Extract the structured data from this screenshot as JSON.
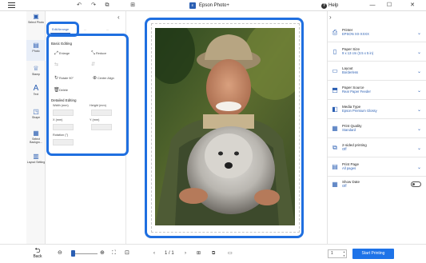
{
  "window": {
    "title": "Epson Photo+",
    "logo_text": "E",
    "help_label": "Help"
  },
  "left_rail": {
    "items": [
      {
        "label": "Select Photo",
        "icon": "photo-select-icon"
      },
      {
        "label": "Photo",
        "icon": "photo-icon"
      },
      {
        "label": "Stamp",
        "icon": "stamp-icon"
      },
      {
        "label": "Text",
        "icon": "text-icon"
      },
      {
        "label": "Shape",
        "icon": "shape-icon"
      },
      {
        "label": "Select Backgro...",
        "icon": "background-icon"
      },
      {
        "label": "Layout Setting",
        "icon": "layout-icon"
      }
    ]
  },
  "edit_panel": {
    "tabs": [
      "Edit/Arrange",
      "...",
      "..."
    ],
    "basic_editing_title": "Basic Editing",
    "tools": {
      "enlarge": "Enlarge",
      "reduce": "Reduce",
      "rotate": "Rotate 90°",
      "center_align": "Center Align",
      "delete": "Delete"
    },
    "detailed_editing_title": "Detailed Editing",
    "fields": {
      "width": "Width (mm)",
      "height": "Height (mm)",
      "x": "X (mm)",
      "y": "Y (mm)",
      "rotation": "Rotation (°)"
    }
  },
  "settings": {
    "items": [
      {
        "label": "Printer",
        "value": "EPSON XX-XXXX",
        "icon": "printer-icon"
      },
      {
        "label": "Paper Size",
        "value": "9 x 13 cm (3.5 x 5 in)",
        "icon": "paper-size-icon"
      },
      {
        "label": "Layout",
        "value": "Borderless",
        "icon": "layout-icon"
      },
      {
        "label": "Paper Source",
        "value": "Rear Paper Feeder",
        "icon": "paper-source-icon"
      },
      {
        "label": "Media Type",
        "value": "Epson Premium Glossy",
        "icon": "media-type-icon"
      },
      {
        "label": "Print Quality",
        "value": "Standard",
        "icon": "print-quality-icon"
      },
      {
        "label": "2-sided printing",
        "value": "Off",
        "icon": "duplex-icon"
      },
      {
        "label": "Print Page",
        "value": "All pages",
        "icon": "print-page-icon"
      },
      {
        "label": "Show Date",
        "value": "Off",
        "icon": "calendar-icon"
      }
    ]
  },
  "bottom_bar": {
    "back_label": "Back",
    "page_indicator": "1 / 1",
    "copies": "1",
    "print_label": "Start Printing"
  },
  "colors": {
    "accent": "#2b5fb3",
    "highlight": "#1f6fe0",
    "print_button": "#1e73e8"
  }
}
